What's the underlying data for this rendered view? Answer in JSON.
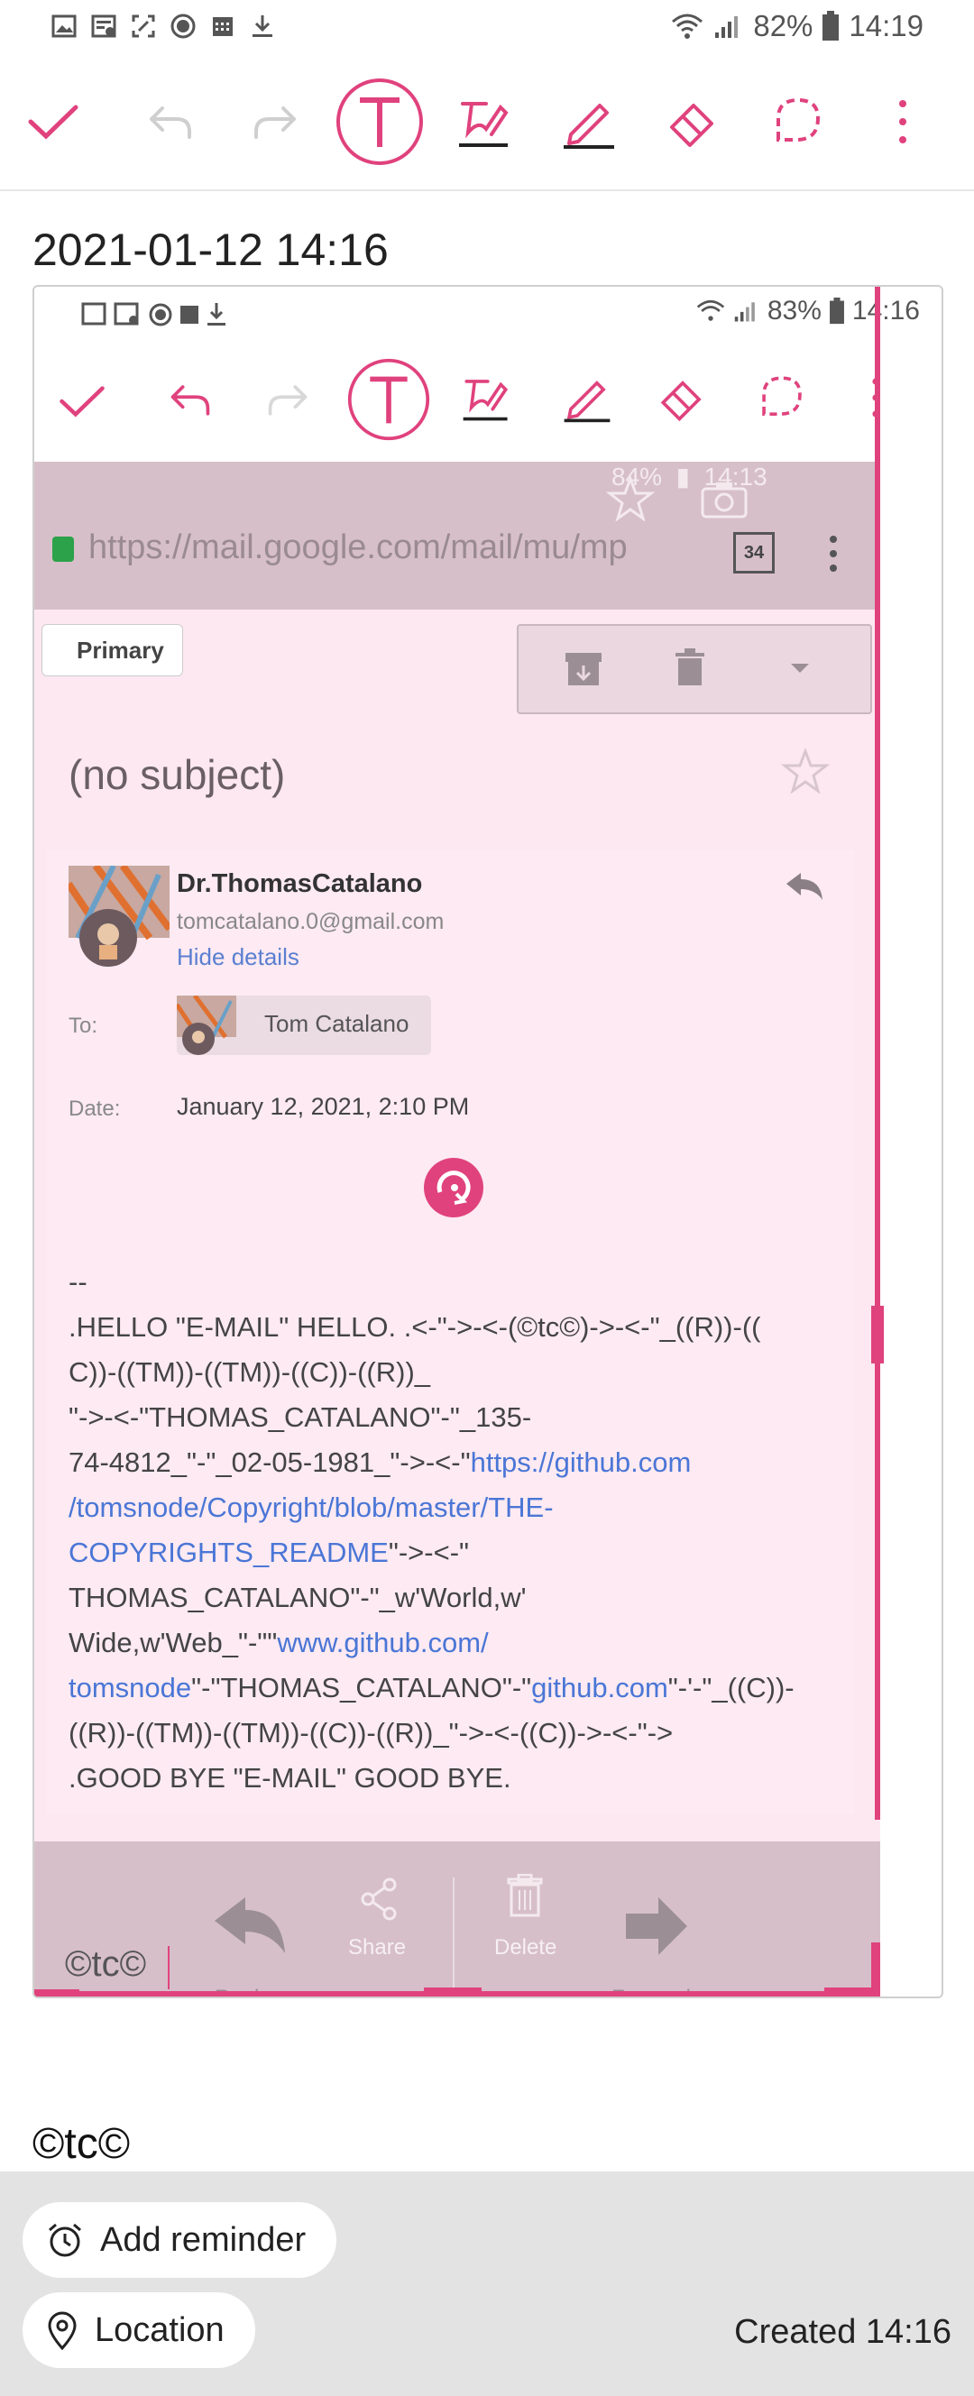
{
  "status_bar": {
    "battery": "82%",
    "time": "14:19",
    "left_icons": [
      "image-icon",
      "news-icon",
      "screenshot-icon",
      "alert-icon",
      "calendar-icon",
      "download-icon"
    ]
  },
  "toolbar": {
    "items": [
      "check-icon",
      "undo-icon",
      "redo-icon",
      "text-icon",
      "handwriting-pen-icon",
      "pencil-icon",
      "eraser-icon",
      "lasso-icon",
      "more-icon"
    ],
    "accent_color": "#e0427d"
  },
  "note": {
    "timestamp": "2021-01-12 14:16",
    "footer_text": "©tc©"
  },
  "inner_screenshot": {
    "status_bar": {
      "battery": "83%",
      "time": "14:16"
    },
    "browser": {
      "status_battery": "84%",
      "status_time": "14:13",
      "url": "https://mail.google.com/mail/mu/mp",
      "tab_count": "34"
    },
    "email": {
      "folder_button": "Primary",
      "subject": "(no subject)",
      "sender_name": "Dr.ThomasCatalano",
      "sender_email": "tomcatalano.0@gmail.com",
      "hide_details": "Hide details",
      "to_label": "To:",
      "to_name": "Tom Catalano",
      "date_label": "Date:",
      "date_value": "January 12, 2021, 2:10 PM",
      "body_lines": [
        "--",
        ".HELLO \"E-MAIL\" HELLO. .<-\"->-<-(©tc©)->-<-\"_((R))-((",
        "C))-((TM))-((TM))-((C))-((R))_",
        "\"->-<-\"THOMAS_CATALANO\"-\"_135-"
      ],
      "body_line5_text": "74-4812_\"-\"_02-05-1981_\"->-<-\"",
      "body_line5_link": "https://github.com",
      "body_line6_link": "/tomsnode/Copyright/blob/master/THE-",
      "body_line7_link": "COPYRIGHTS_README",
      "body_line7_text": "\"->-<-\"",
      "body_line8": "THOMAS_CATALANO\"-\"_w'World,w'",
      "body_line9_text": "Wide,w'Web_\"-\"\"",
      "body_line9_link": "www.github.com/",
      "body_line10_link": "tomsnode",
      "body_line10_text_a": "\"-\"THOMAS_CATALANO\"-\"",
      "body_line10_link2": "github.com",
      "body_line10_text_b": "\"-'-\"_((C))-",
      "body_line11": "((R))-((TM))-((TM))-((C))-((R))_\"->-<-((C))->-<-\"->",
      "body_line12": ".GOOD BYE \"E-MAIL\" GOOD BYE.",
      "actions": {
        "share": "Share",
        "delete": "Delete",
        "reply": "Reply",
        "forward": "Forward"
      },
      "handwritten": "©tc©"
    }
  },
  "bottom": {
    "add_reminder": "Add reminder",
    "location": "Location",
    "created": "Created 14:16"
  }
}
